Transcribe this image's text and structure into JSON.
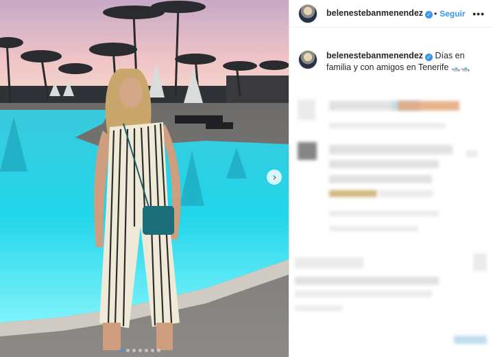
{
  "post": {
    "username": "belenestebanmenendez",
    "follow_label": "Seguir",
    "more_icon": "•••",
    "caption_text": "Días en familia y con amigos en Tenerife",
    "caption_emoji": "🛥️🛥️",
    "next_icon": "›",
    "carousel": {
      "count": 7,
      "active_index": 0
    }
  },
  "colors": {
    "accent": "#3897f0",
    "pool": "#2fd3e4",
    "sky": "#f1c7c9"
  }
}
